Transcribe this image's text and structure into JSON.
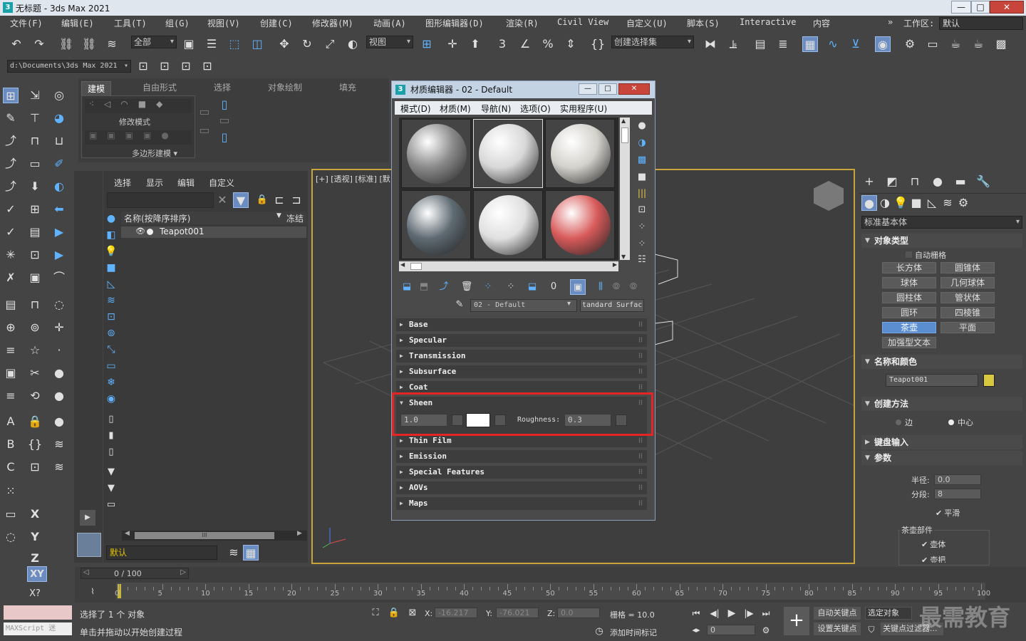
{
  "window": {
    "title": "无标题 - 3ds Max 2021",
    "controls": [
      "—",
      "□",
      "✕"
    ]
  },
  "menubar": {
    "items": [
      "文件(F)",
      "编辑(E)",
      "工具(T)",
      "组(G)",
      "视图(V)",
      "创建(C)",
      "修改器(M)",
      "动画(A)",
      "图形编辑器(D)",
      "渲染(R)",
      "Civil View",
      "自定义(U)",
      "脚本(S)",
      "Interactive",
      "内容"
    ],
    "workspace_label": "工作区:",
    "workspace_value": "默认"
  },
  "main_toolbar": {
    "filter_value": "全部",
    "view_value": "视图",
    "selection_set": "创建选择集",
    "project_path": "d:\\Documents\\3ds Max 2021"
  },
  "ribbon": {
    "tabs": [
      "建模",
      "自由形式",
      "选择",
      "对象绘制",
      "填充"
    ],
    "modify_mode_label": "修改模式",
    "poly_modeling_label": "多边形建模 ▾"
  },
  "scene_explorer": {
    "tabs": [
      "选择",
      "显示",
      "编辑",
      "自定义"
    ],
    "column_name": "名称(按降序排序)",
    "column_freeze": "冻结",
    "object_name": "Teapot001",
    "layer_value": "默认",
    "scroll_label": "III"
  },
  "viewport": {
    "label": "[+] [透视] [标准] [默"
  },
  "material_editor": {
    "title": "材质编辑器 - 02 - Default",
    "menu": [
      "模式(D)",
      "材质(M)",
      "导航(N)",
      "选项(O)",
      "实用程序(U)"
    ],
    "material_name": "02 - Default",
    "material_type": "tandard Surfac",
    "rollouts_top": [
      "Base",
      "Specular",
      "Transmission",
      "Subsurface",
      "Coat"
    ],
    "sheen": {
      "label": "Sheen",
      "weight": "1.0",
      "roughness_label": "Roughness:",
      "roughness": "0.3"
    },
    "rollouts_bottom": [
      "Thin Film",
      "Emission",
      "Special Features",
      "AOVs",
      "Maps"
    ],
    "slot_colors": [
      "#8a8a8a",
      "#d8d8d8",
      "#d4d2cc",
      "#5e6a72",
      "#e0e0e0",
      "#d85a5a"
    ]
  },
  "command_panel": {
    "category": "标准基本体",
    "object_type_title": "对象类型",
    "autogrid": "自动栅格",
    "primitives": [
      "长方体",
      "圆锥体",
      "球体",
      "几何球体",
      "圆柱体",
      "管状体",
      "圆环",
      "四棱锥",
      "茶壶",
      "平面",
      "加强型文本"
    ],
    "active_primitive": "茶壶",
    "name_color_title": "名称和颜色",
    "object_name": "Teapot001",
    "object_color": "#d8c840",
    "creation_method_title": "创建方法",
    "method_edge": "边",
    "method_center": "中心",
    "keyboard_input_title": "键盘输入",
    "params_title": "参数",
    "radius_label": "半径:",
    "radius_value": "0.0",
    "segments_label": "分段:",
    "segments_value": "8",
    "smooth_label": "平滑",
    "teapot_parts_label": "茶壶部件",
    "part_body": "壶体",
    "part_handle": "壶把"
  },
  "timeline": {
    "frame_counter": "0 / 100",
    "ticks": [
      "0",
      "5",
      "10",
      "15",
      "20",
      "25",
      "30",
      "35",
      "40",
      "45",
      "50",
      "55",
      "60",
      "65",
      "70",
      "75",
      "80",
      "85",
      "90",
      "95",
      "100"
    ]
  },
  "statusbar": {
    "maxscript_label": "MAXScript 迷",
    "selection_status": "选择了 1 个 对象",
    "prompt": "单击并拖动以开始创建过程",
    "x_label": "X:",
    "x_value": "-16.217",
    "y_label": "Y:",
    "y_value": "-76.021",
    "z_label": "Z:",
    "z_value": "0.0",
    "grid_label": "栅格 = 10.0",
    "add_time_tag": "添加时间标记",
    "auto_key": "自动关键点",
    "selected_object": "选定对象",
    "set_key": "设置关键点",
    "key_filters": "关键点过滤器...",
    "current_frame": "0",
    "watermark": "最需教育"
  }
}
